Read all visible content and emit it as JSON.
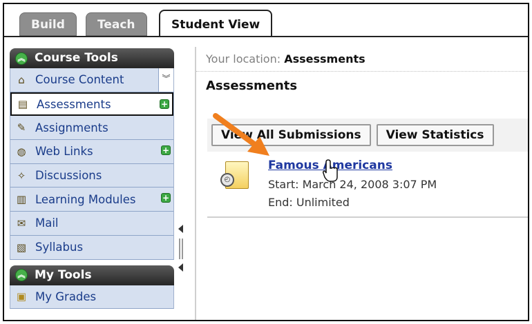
{
  "tabs": [
    {
      "label": "Build",
      "active": false
    },
    {
      "label": "Teach",
      "active": false
    },
    {
      "label": "Student View",
      "active": true
    }
  ],
  "course_tools": {
    "title": "Course Tools",
    "items": [
      {
        "label": "Course Content",
        "icon": "home-icon",
        "badge": false
      },
      {
        "label": "Assessments",
        "icon": "assessment-icon",
        "badge": true,
        "selected": true
      },
      {
        "label": "Assignments",
        "icon": "assignment-icon",
        "badge": false
      },
      {
        "label": "Web Links",
        "icon": "globe-icon",
        "badge": true
      },
      {
        "label": "Discussions",
        "icon": "pushpin-icon",
        "badge": false
      },
      {
        "label": "Learning Modules",
        "icon": "module-icon",
        "badge": true
      },
      {
        "label": "Mail",
        "icon": "mail-icon",
        "badge": false
      },
      {
        "label": "Syllabus",
        "icon": "syllabus-icon",
        "badge": false
      }
    ]
  },
  "my_tools": {
    "title": "My Tools",
    "items": [
      {
        "label": "My Grades",
        "icon": "grades-icon"
      }
    ]
  },
  "content": {
    "location_label": "Your location:",
    "location_value": "Assessments",
    "title": "Assessments",
    "buttons": {
      "view_all": "View All Submissions",
      "view_stats": "View Statistics"
    },
    "assessment": {
      "name": "Famous Americans",
      "start": "Start: March 24, 2008 3:07 PM",
      "end": "End: Unlimited"
    }
  },
  "colors": {
    "accent_arrow": "#f07f1e",
    "link": "#1f38a0",
    "panel_head": "#2f2f2f",
    "tool_item_bg": "#d6e0f0"
  }
}
